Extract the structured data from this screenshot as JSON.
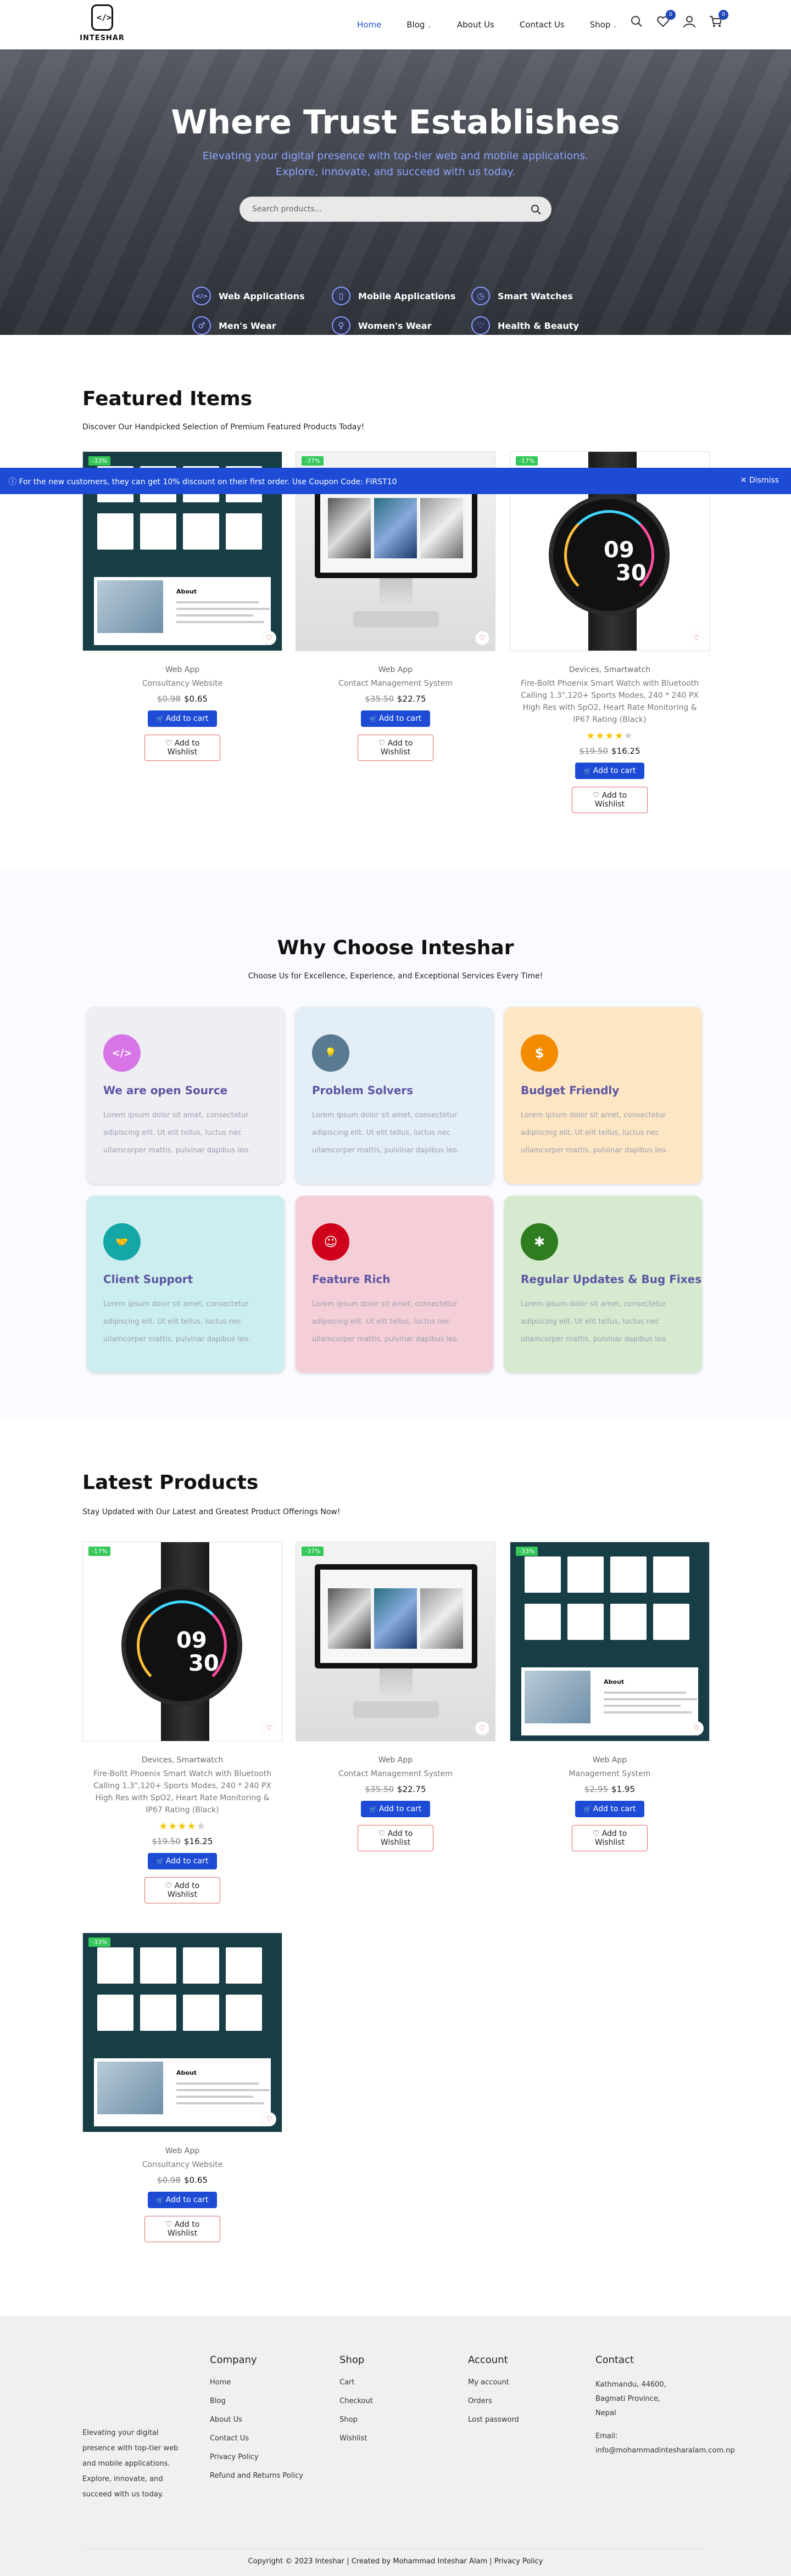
{
  "brand": {
    "name": "INTESHAR"
  },
  "nav": {
    "items": [
      {
        "label": "Home",
        "active": true,
        "dropdown": false
      },
      {
        "label": "Blog",
        "active": false,
        "dropdown": true
      },
      {
        "label": "About Us",
        "active": false,
        "dropdown": false
      },
      {
        "label": "Contact Us",
        "active": false,
        "dropdown": false
      },
      {
        "label": "Shop",
        "active": false,
        "dropdown": true
      }
    ],
    "wishlist_count": "0",
    "cart_count": "0"
  },
  "hero": {
    "title": "Where Trust Establishes",
    "subtitle": "Elevating your digital presence with top-tier web and mobile applications. Explore, innovate, and succeed with us today.",
    "search_placeholder": "Search products...",
    "categories": [
      {
        "label": "Web Applications",
        "icon": "code-icon"
      },
      {
        "label": "Mobile Applications",
        "icon": "mobile-icon"
      },
      {
        "label": "Smart Watches",
        "icon": "watch-icon"
      },
      {
        "label": "Men's Wear",
        "icon": "male-icon"
      },
      {
        "label": "Women's Wear",
        "icon": "female-icon"
      },
      {
        "label": "Health & Beauty",
        "icon": "heart-icon"
      }
    ]
  },
  "promo": {
    "text": "For the new customers, they can get 10% discount on their first order. Use Coupon Code: FIRST10",
    "dismiss": "Dismiss"
  },
  "featured": {
    "title": "Featured Items",
    "subtitle": "Discover Our Handpicked Selection of Premium Featured Products Today!",
    "products": [
      {
        "sale": "-33%",
        "category": "Web App",
        "name": "Consultancy Website",
        "old_price": "$0.98",
        "price": "$0.65",
        "image": "website-mockup",
        "rating": null
      },
      {
        "sale": "-37%",
        "category": "Web App",
        "name": "Contact Management System",
        "old_price": "$35.50",
        "price": "$22.75",
        "image": "monitor-mockup",
        "rating": null
      },
      {
        "sale": "-17%",
        "category": "Devices, Smartwatch",
        "name": "Fire-Boltt Phoenix Smart Watch with Bluetooth Calling 1.3\",120+ Sports Modes, 240 * 240 PX High Res with SpO2, Heart Rate Monitoring & IP67 Rating (Black)",
        "old_price": "$19.50",
        "price": "$16.25",
        "image": "watch",
        "rating": 3.5
      }
    ]
  },
  "product_labels": {
    "add_to_cart": "Add to cart",
    "add_to_wishlist": "Add to Wishlist"
  },
  "why": {
    "title": "Why Choose Inteshar",
    "subtitle": "Choose Us for Excellence, Experience, and Exceptional Services Every Time!",
    "features": [
      {
        "title": "We are open Source",
        "text": "Lorem ipsum dolor sit amet, consectetur adipiscing elit. Ut elit tellus, luctus nec ullamcorper mattis, pulvinar dapibus leo.",
        "bg": "#eeeef3",
        "icon_bg": "#d774e6",
        "icon": "code-icon",
        "glyph": "</>"
      },
      {
        "title": "Problem Solvers",
        "text": "Lorem ipsum dolor sit amet, consectetur adipiscing elit. Ut elit tellus, luctus nec ullamcorper mattis, pulvinar dapibus leo.",
        "bg": "#e3eef7",
        "icon_bg": "#5a7a92",
        "icon": "lightbulb-icon",
        "glyph": "💡"
      },
      {
        "title": "Budget Friendly",
        "text": "Lorem ipsum dolor sit amet, consectetur adipiscing elit. Ut elit tellus, luctus nec ullamcorper mattis, pulvinar dapibus leo.",
        "bg": "#fde6c4",
        "icon_bg": "#f28b00",
        "icon": "money-icon",
        "glyph": "$"
      },
      {
        "title": "Client Support",
        "text": "Lorem ipsum dolor sit amet, consectetur adipiscing elit. Ut elit tellus, luctus nec ullamcorper mattis, pulvinar dapibus leo.",
        "bg": "#cdeeee",
        "icon_bg": "#15a6a6",
        "icon": "handshake-icon",
        "glyph": "🤝"
      },
      {
        "title": "Feature Rich",
        "text": "Lorem ipsum dolor sit amet, consectetur adipiscing elit. Ut elit tellus, luctus nec ullamcorper mattis, pulvinar dapibus leo.",
        "bg": "#f5cfd7",
        "icon_bg": "#d0021b",
        "icon": "robot-icon",
        "glyph": "☺"
      },
      {
        "title": "Regular Updates & Bug Fixes",
        "text": "Lorem ipsum dolor sit amet, consectetur adipiscing elit. Ut elit tellus, luctus nec ullamcorper mattis, pulvinar dapibus leo.",
        "bg": "#d6ead0",
        "icon_bg": "#2e7d1e",
        "icon": "bug-icon",
        "glyph": "✱"
      }
    ]
  },
  "latest": {
    "title": "Latest Products",
    "subtitle": "Stay Updated with Our Latest and Greatest Product Offerings Now!",
    "products": [
      {
        "sale": "-17%",
        "category": "Devices, Smartwatch",
        "name": "Fire-Boltt Phoenix Smart Watch with Bluetooth Calling 1.3\",120+ Sports Modes, 240 * 240 PX High Res with SpO2, Heart Rate Monitoring & IP67 Rating (Black)",
        "old_price": "$19.50",
        "price": "$16.25",
        "image": "watch",
        "rating": 3.5
      },
      {
        "sale": "-37%",
        "category": "Web App",
        "name": "Contact Management System",
        "old_price": "$35.50",
        "price": "$22.75",
        "image": "monitor-mockup",
        "rating": null
      },
      {
        "sale": "-33%",
        "category": "Web App",
        "name": "Management System",
        "old_price": "$2.95",
        "price": "$1.95",
        "image": "website-mockup",
        "rating": null
      },
      {
        "sale": "-33%",
        "category": "Web App",
        "name": "Consultancy Website",
        "old_price": "$0.98",
        "price": "$0.65",
        "image": "website-mockup",
        "rating": null
      }
    ]
  },
  "footer": {
    "about": "Elevating your digital presence with top-tier web and mobile applications. Explore, innovate, and succeed with us today.",
    "columns": [
      {
        "title": "Company",
        "links": [
          "Home",
          "Blog",
          "About Us",
          "Contact Us",
          "Privacy Policy",
          "Refund and Returns Policy"
        ]
      },
      {
        "title": "Shop",
        "links": [
          "Cart",
          "Checkout",
          "Shop",
          "Wishlist"
        ]
      },
      {
        "title": "Account",
        "links": [
          "My account",
          "Orders",
          "Lost password"
        ]
      },
      {
        "title": "Contact",
        "links": [
          "Kathmandu, 44600, Bagmati Province, Nepal",
          "Email: info@mohammadintesharalam.com.np"
        ]
      }
    ],
    "copyright": "Copyright © 2023 Inteshar | Created by Mohammad Inteshar Alam | Privacy Policy"
  }
}
